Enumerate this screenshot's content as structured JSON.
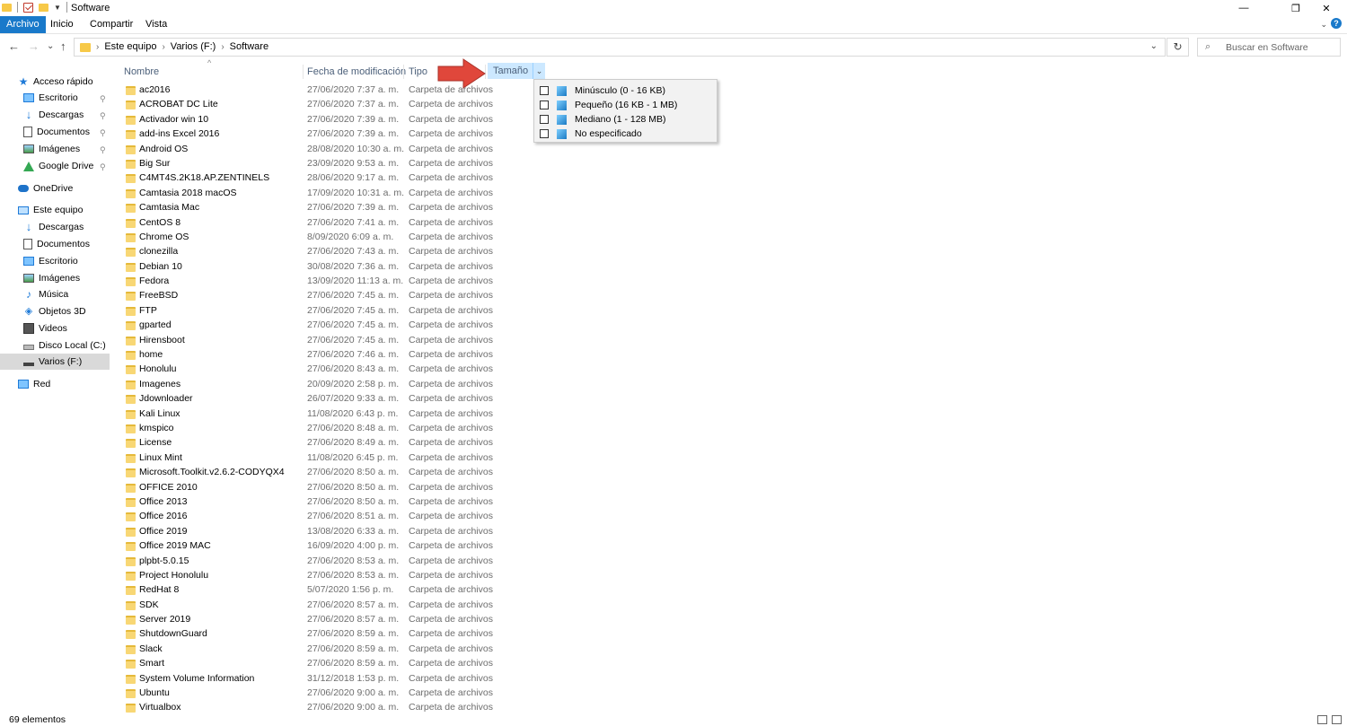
{
  "window": {
    "title": "Software",
    "minimize": "—",
    "maximize": "❐",
    "close": "✕"
  },
  "ribbon": {
    "tabs": [
      "Archivo",
      "Inicio",
      "Compartir",
      "Vista"
    ],
    "expand": "⌄",
    "help": "?"
  },
  "nav": {
    "back": "←",
    "forward": "→",
    "recent": "⌄",
    "up": "↑"
  },
  "address": {
    "crumbs": [
      "Este equipo",
      "Varios (F:)",
      "Software"
    ],
    "separator": "›",
    "dropdown": "⌄",
    "refresh": "↻"
  },
  "search": {
    "placeholder": "Buscar en Software",
    "icon": "⌕"
  },
  "sidebar": {
    "items": [
      {
        "label": "Acceso rápido",
        "icon": "star-icon",
        "pinned": false
      },
      {
        "label": "Escritorio",
        "icon": "desktop-icon",
        "pinned": true
      },
      {
        "label": "Descargas",
        "icon": "download-icon",
        "pinned": true
      },
      {
        "label": "Documentos",
        "icon": "document-icon",
        "pinned": true
      },
      {
        "label": "Imágenes",
        "icon": "image-icon",
        "pinned": true
      },
      {
        "label": "Google Drive",
        "icon": "google-drive-icon",
        "pinned": true
      },
      {
        "label": "OneDrive",
        "icon": "cloud-icon",
        "pinned": false
      },
      {
        "label": "Este equipo",
        "icon": "computer-icon",
        "pinned": false
      },
      {
        "label": "Descargas",
        "icon": "download-icon",
        "pinned": false
      },
      {
        "label": "Documentos",
        "icon": "document-icon",
        "pinned": false
      },
      {
        "label": "Escritorio",
        "icon": "desktop-icon",
        "pinned": false
      },
      {
        "label": "Imágenes",
        "icon": "image-icon",
        "pinned": false
      },
      {
        "label": "Música",
        "icon": "music-icon",
        "pinned": false
      },
      {
        "label": "Objetos 3D",
        "icon": "cube-3d-icon",
        "pinned": false
      },
      {
        "label": "Videos",
        "icon": "video-icon",
        "pinned": false
      },
      {
        "label": "Disco Local (C:)",
        "icon": "disk-icon",
        "pinned": false
      },
      {
        "label": "Varios (F:)",
        "icon": "usb-drive-icon",
        "pinned": false
      },
      {
        "label": "Red",
        "icon": "network-icon",
        "pinned": false
      }
    ],
    "pin_glyph": "📌"
  },
  "columns": {
    "name": "Nombre",
    "modified": "Fecha de modificación",
    "type": "Tipo",
    "size": "Tamaño",
    "size_dropdown": "⌄",
    "sort_indicator": "^"
  },
  "files": [
    {
      "name": "ac2016",
      "date": "27/06/2020 7:37 a. m.",
      "type": "Carpeta de archivos"
    },
    {
      "name": "ACROBAT DC Lite",
      "date": "27/06/2020 7:37 a. m.",
      "type": "Carpeta de archivos"
    },
    {
      "name": "Activador win 10",
      "date": "27/06/2020 7:39 a. m.",
      "type": "Carpeta de archivos"
    },
    {
      "name": "add-ins Excel 2016",
      "date": "27/06/2020 7:39 a. m.",
      "type": "Carpeta de archivos"
    },
    {
      "name": "Android OS",
      "date": "28/08/2020 10:30 a. m.",
      "type": "Carpeta de archivos"
    },
    {
      "name": "Big Sur",
      "date": "23/09/2020 9:53 a. m.",
      "type": "Carpeta de archivos"
    },
    {
      "name": "C4MT4S.2K18.AP.ZENTINELS",
      "date": "28/06/2020 9:17 a. m.",
      "type": "Carpeta de archivos"
    },
    {
      "name": "Camtasia 2018 macOS",
      "date": "17/09/2020 10:31 a. m.",
      "type": "Carpeta de archivos"
    },
    {
      "name": "Camtasia Mac",
      "date": "27/06/2020 7:39 a. m.",
      "type": "Carpeta de archivos"
    },
    {
      "name": "CentOS 8",
      "date": "27/06/2020 7:41 a. m.",
      "type": "Carpeta de archivos"
    },
    {
      "name": "Chrome OS",
      "date": "8/09/2020 6:09 a. m.",
      "type": "Carpeta de archivos"
    },
    {
      "name": "clonezilla",
      "date": "27/06/2020 7:43 a. m.",
      "type": "Carpeta de archivos"
    },
    {
      "name": "Debian 10",
      "date": "30/08/2020 7:36 a. m.",
      "type": "Carpeta de archivos"
    },
    {
      "name": "Fedora",
      "date": "13/09/2020 11:13 a. m.",
      "type": "Carpeta de archivos"
    },
    {
      "name": "FreeBSD",
      "date": "27/06/2020 7:45 a. m.",
      "type": "Carpeta de archivos"
    },
    {
      "name": "FTP",
      "date": "27/06/2020 7:45 a. m.",
      "type": "Carpeta de archivos"
    },
    {
      "name": "gparted",
      "date": "27/06/2020 7:45 a. m.",
      "type": "Carpeta de archivos"
    },
    {
      "name": "Hirensboot",
      "date": "27/06/2020 7:45 a. m.",
      "type": "Carpeta de archivos"
    },
    {
      "name": "home",
      "date": "27/06/2020 7:46 a. m.",
      "type": "Carpeta de archivos"
    },
    {
      "name": "Honolulu",
      "date": "27/06/2020 8:43 a. m.",
      "type": "Carpeta de archivos"
    },
    {
      "name": "Imagenes",
      "date": "20/09/2020 2:58 p. m.",
      "type": "Carpeta de archivos"
    },
    {
      "name": "Jdownloader",
      "date": "26/07/2020 9:33 a. m.",
      "type": "Carpeta de archivos"
    },
    {
      "name": "Kali Linux",
      "date": "11/08/2020 6:43 p. m.",
      "type": "Carpeta de archivos"
    },
    {
      "name": "kmspico",
      "date": "27/06/2020 8:48 a. m.",
      "type": "Carpeta de archivos"
    },
    {
      "name": "License",
      "date": "27/06/2020 8:49 a. m.",
      "type": "Carpeta de archivos"
    },
    {
      "name": "Linux Mint",
      "date": "11/08/2020 6:45 p. m.",
      "type": "Carpeta de archivos"
    },
    {
      "name": "Microsoft.Toolkit.v2.6.2-CODYQX4",
      "date": "27/06/2020 8:50 a. m.",
      "type": "Carpeta de archivos"
    },
    {
      "name": "OFFICE 2010",
      "date": "27/06/2020 8:50 a. m.",
      "type": "Carpeta de archivos"
    },
    {
      "name": "Office 2013",
      "date": "27/06/2020 8:50 a. m.",
      "type": "Carpeta de archivos"
    },
    {
      "name": "Office 2016",
      "date": "27/06/2020 8:51 a. m.",
      "type": "Carpeta de archivos"
    },
    {
      "name": "Office 2019",
      "date": "13/08/2020 6:33 a. m.",
      "type": "Carpeta de archivos"
    },
    {
      "name": "Office 2019 MAC",
      "date": "16/09/2020 4:00 p. m.",
      "type": "Carpeta de archivos"
    },
    {
      "name": "plpbt-5.0.15",
      "date": "27/06/2020 8:53 a. m.",
      "type": "Carpeta de archivos"
    },
    {
      "name": "Project Honolulu",
      "date": "27/06/2020 8:53 a. m.",
      "type": "Carpeta de archivos"
    },
    {
      "name": "RedHat 8",
      "date": "5/07/2020 1:56 p. m.",
      "type": "Carpeta de archivos"
    },
    {
      "name": "SDK",
      "date": "27/06/2020 8:57 a. m.",
      "type": "Carpeta de archivos"
    },
    {
      "name": "Server 2019",
      "date": "27/06/2020 8:57 a. m.",
      "type": "Carpeta de archivos"
    },
    {
      "name": "ShutdownGuard",
      "date": "27/06/2020 8:59 a. m.",
      "type": "Carpeta de archivos"
    },
    {
      "name": "Slack",
      "date": "27/06/2020 8:59 a. m.",
      "type": "Carpeta de archivos"
    },
    {
      "name": "Smart",
      "date": "27/06/2020 8:59 a. m.",
      "type": "Carpeta de archivos"
    },
    {
      "name": "System Volume Information",
      "date": "31/12/2018 1:53 p. m.",
      "type": "Carpeta de archivos"
    },
    {
      "name": "Ubuntu",
      "date": "27/06/2020 9:00 a. m.",
      "type": "Carpeta de archivos"
    },
    {
      "name": "Virtualbox",
      "date": "27/06/2020 9:00 a. m.",
      "type": "Carpeta de archivos"
    }
  ],
  "size_filter": {
    "options": [
      "Minúsculo (0 - 16 KB)",
      "Pequeño (16 KB - 1 MB)",
      "Mediano (1 - 128 MB)",
      "No especificado"
    ]
  },
  "status": {
    "count": "69 elementos"
  },
  "colors": {
    "accent": "#1979ca",
    "folder": "#f8d775",
    "header_highlight": "#cce8ff",
    "arrow": "#e0473b"
  }
}
